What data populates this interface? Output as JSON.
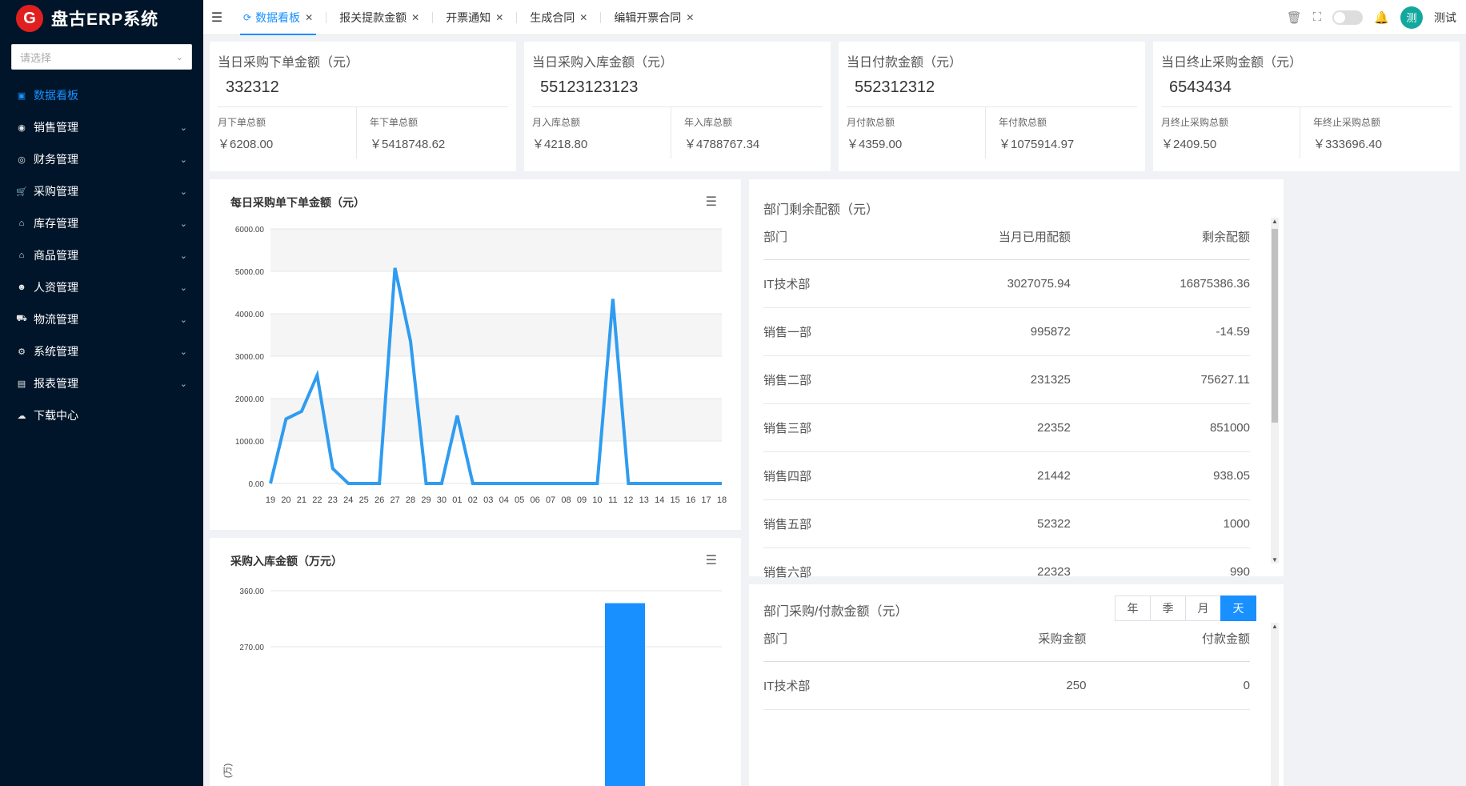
{
  "app": {
    "logo_text": "盘古ERP系统",
    "logo_glyph": "G"
  },
  "sidebar": {
    "select_placeholder": "请选择",
    "items": [
      {
        "label": "数据看板",
        "icon": "chart-icon",
        "active": true
      },
      {
        "label": "销售管理",
        "icon": "sales-icon"
      },
      {
        "label": "财务管理",
        "icon": "finance-icon"
      },
      {
        "label": "采购管理",
        "icon": "cart-icon"
      },
      {
        "label": "库存管理",
        "icon": "warehouse-icon"
      },
      {
        "label": "商品管理",
        "icon": "goods-icon"
      },
      {
        "label": "人资管理",
        "icon": "person-icon"
      },
      {
        "label": "物流管理",
        "icon": "truck-icon"
      },
      {
        "label": "系统管理",
        "icon": "gear-icon"
      },
      {
        "label": "报表管理",
        "icon": "report-icon"
      },
      {
        "label": "下载中心",
        "icon": "download-icon"
      }
    ]
  },
  "header": {
    "tabs": [
      {
        "label": "数据看板",
        "active": true
      },
      {
        "label": "报关提款金额"
      },
      {
        "label": "开票通知"
      },
      {
        "label": "生成合同"
      },
      {
        "label": "编辑开票合同"
      }
    ],
    "avatar_text": "测",
    "user_name": "测试"
  },
  "stats": [
    {
      "title": "当日采购下单金额（元）",
      "value": "332312",
      "sub1_label": "月下单总额",
      "sub1_value": "￥6208.00",
      "sub2_label": "年下单总额",
      "sub2_value": "￥5418748.62"
    },
    {
      "title": "当日采购入库金额（元）",
      "value": "55123123123",
      "sub1_label": "月入库总额",
      "sub1_value": "￥4218.80",
      "sub2_label": "年入库总额",
      "sub2_value": "￥4788767.34"
    },
    {
      "title": "当日付款金额（元）",
      "value": "552312312",
      "sub1_label": "月付款总额",
      "sub1_value": "￥4359.00",
      "sub2_label": "年付款总额",
      "sub2_value": "￥1075914.97"
    },
    {
      "title": "当日终止采购金额（元）",
      "value": "6543434",
      "sub1_label": "月终止采购总额",
      "sub1_value": "￥2409.50",
      "sub2_label": "年终止采购总额",
      "sub2_value": "￥333696.40"
    }
  ],
  "chart_data": [
    {
      "type": "line",
      "title": "每日采购单下单金额（元）",
      "x": [
        "19",
        "20",
        "21",
        "22",
        "23",
        "24",
        "25",
        "26",
        "27",
        "28",
        "29",
        "30",
        "01",
        "02",
        "03",
        "04",
        "05",
        "06",
        "07",
        "08",
        "09",
        "10",
        "11",
        "12",
        "13",
        "14",
        "15",
        "16",
        "17",
        "18"
      ],
      "values": [
        0,
        1520,
        1700,
        2550,
        350,
        0,
        0,
        0,
        5080,
        3350,
        0,
        0,
        1600,
        0,
        0,
        0,
        0,
        0,
        0,
        0,
        0,
        0,
        4350,
        0,
        0,
        0,
        0,
        0,
        0,
        0
      ],
      "yticks": [
        "0.00",
        "1000.00",
        "2000.00",
        "3000.00",
        "4000.00",
        "5000.00",
        "6000.00"
      ],
      "ylim": [
        0,
        6000
      ],
      "color": "#2f9cf0",
      "grid": true
    },
    {
      "type": "bar",
      "title": "采购入库金额（万元）",
      "ylabel_fragment": "(万)",
      "yticks": [
        "270.00",
        "360.00"
      ],
      "ylim": [
        0,
        360
      ],
      "visible_bar_value": 340,
      "color": "#1890ff"
    }
  ],
  "dept_quota": {
    "title": "部门剩余配额（元）",
    "headers": [
      "部门",
      "当月已用配额",
      "剩余配额"
    ],
    "rows": [
      [
        "IT技术部",
        "3027075.94",
        "16875386.36"
      ],
      [
        "销售一部",
        "995872",
        "-14.59"
      ],
      [
        "销售二部",
        "231325",
        "75627.11"
      ],
      [
        "销售三部",
        "22352",
        "851000"
      ],
      [
        "销售四部",
        "21442",
        "938.05"
      ],
      [
        "销售五部",
        "52322",
        "1000"
      ],
      [
        "销售六部",
        "22323",
        "990"
      ]
    ]
  },
  "dept_purchase": {
    "title": "部门采购/付款金额（元）",
    "periods": [
      "年",
      "季",
      "月",
      "天"
    ],
    "active_period": "天",
    "headers": [
      "部门",
      "采购金额",
      "付款金额"
    ],
    "rows": [
      [
        "IT技术部",
        "250",
        "0"
      ]
    ]
  }
}
